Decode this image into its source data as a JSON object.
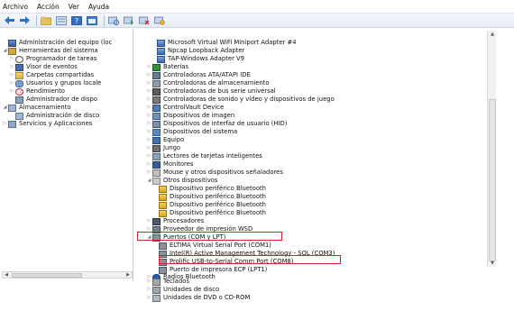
{
  "menubar": {
    "items": [
      "Archivo",
      "Acción",
      "Ver",
      "Ayuda"
    ]
  },
  "toolbar": {
    "buttons": [
      "back-arrow-icon",
      "forward-arrow-icon",
      "up-folder-icon",
      "properties-icon",
      "help-icon",
      "console-icon",
      "scan-hardware-icon",
      "update-driver-icon",
      "uninstall-icon",
      "disable-icon"
    ]
  },
  "left_tree": {
    "items": [
      "Administración del equipo (loc",
      "Herramientas del sistema",
      "Programador de tareas",
      "Visor de eventos",
      "Carpetas compartidas",
      "Usuarios y grupos locale",
      "Rendimiento",
      "Administrador de dispo",
      "Almacenamiento",
      "Administración de disco",
      "Servicios y Aplicaciones"
    ]
  },
  "right_tree": {
    "items": [
      "Microsoft Virtual WiFi Miniport Adapter #4",
      "Npcap Loopback Adapter",
      "TAP-Windows Adapter V9",
      "Baterías",
      "Controladoras ATA/ATAPI IDE",
      "Controladoras de almacenamiento",
      "Controladoras de bus serie universal",
      "Controladoras de sonido y vídeo y dispositivos de juego",
      "ControlVault Device",
      "Dispositivos de imagen",
      "Dispositivos de interfaz de usuario (HID)",
      "Dispositivos del sistema",
      "Equipo",
      "Jungo",
      "Lectores de tarjetas inteligentes",
      "Monitores",
      "Mouse y otros dispositivos señaladores",
      "Otros dispositivos",
      "Dispositivo periférico Bluetooth",
      "Dispositivo periférico Bluetooth",
      "Dispositivo periférico Bluetooth",
      "Dispositivo periférico Bluetooth",
      "Procesadores",
      "Proveedor de impresión WSD",
      "Puertos (COM y LPT)",
      "ELTIMA Virtual Serial Port (COM1)",
      "Intel(R) Active Management Technology - SOL (COM3)",
      "Prolific USB-to-Serial Comm Port (COM8)",
      "Puerto de impresora ECP (LPT1)",
      "Radios Bluetooth",
      "Teclados",
      "Unidades de disco",
      "Unidades de DVD o CD-ROM"
    ]
  },
  "colors": {
    "highlight": "#d8232a",
    "toolbar_bg": "#e9eef5"
  }
}
